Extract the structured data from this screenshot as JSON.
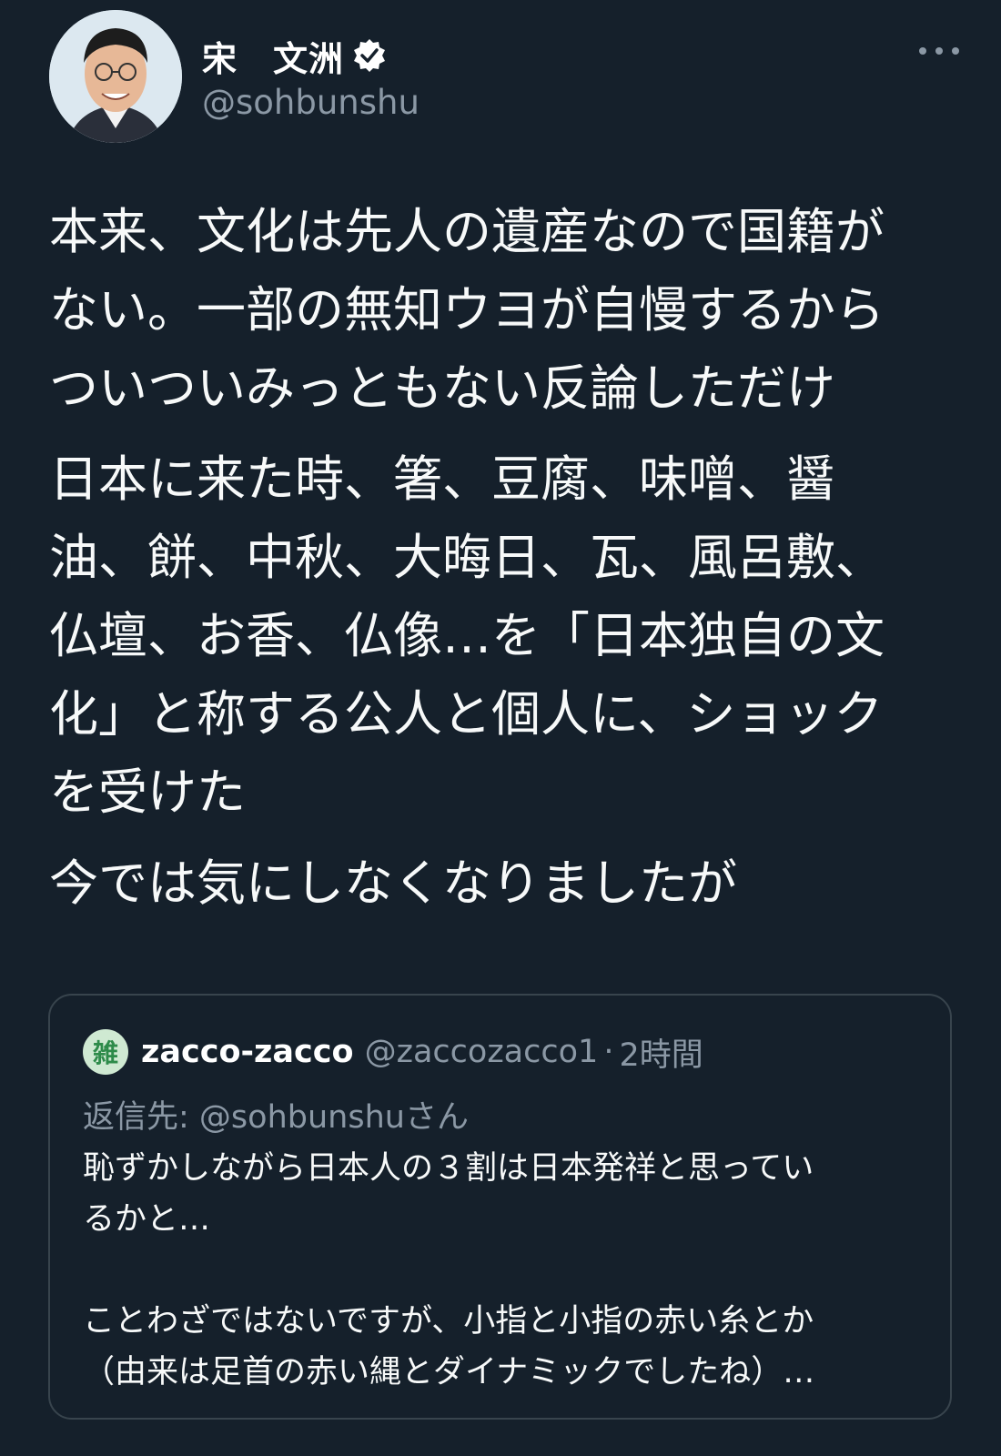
{
  "author": {
    "display_name": "宋　文洲",
    "handle": "@sohbunshu",
    "verified_icon": "verified-badge-icon",
    "more_icon": "more-dots-icon"
  },
  "tweet": {
    "paragraphs": [
      "本来、文化は先人の遺産なので国籍が\nない。一部の無知ウヨが自慢するから\nついついみっともない反論しただけ",
      "日本に来た時、箸、豆腐、味噌、醤\n油、餅、中秋、大晦日、瓦、風呂敷、\n仏壇、お香、仏像…を「日本独自の文\n化」と称する公人と個人に、ショック\nを受けた",
      "今では気にしなくなりましたが"
    ]
  },
  "quoted_tweet": {
    "avatar_text": "雑",
    "display_name": "zacco-zacco",
    "handle": "@zaccozacco1",
    "separator": "·",
    "time": "2時間",
    "reply_prefix": "返信先: ",
    "reply_handle": "@sohbunshu",
    "reply_suffix": "さん",
    "text_1": "恥ずかしながら日本人の３割は日本発祥と思ってい\nるかと…",
    "text_2": "ことわざではないですが、小指と小指の赤い糸とか\n（由来は足首の赤い縄とダイナミックでしたね）…"
  },
  "colors": {
    "background": "#15202b",
    "text": "#f7f9f9",
    "secondary": "#8b98a5",
    "border": "#38444d"
  }
}
